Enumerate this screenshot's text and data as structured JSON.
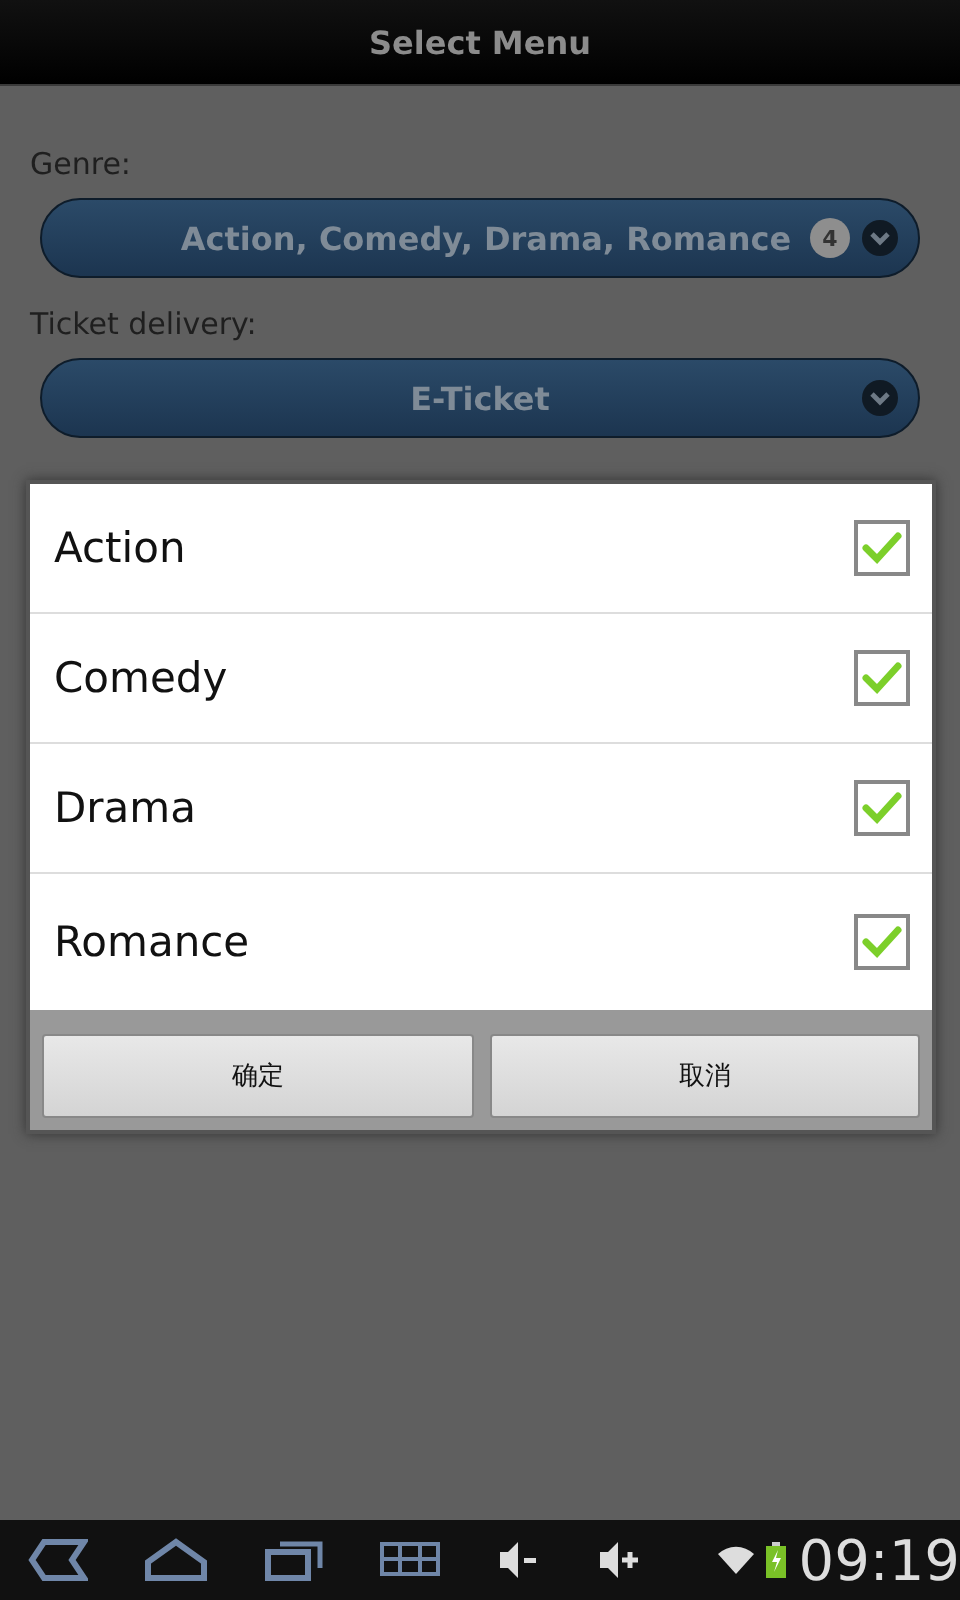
{
  "header": {
    "title": "Select Menu"
  },
  "fields": [
    {
      "label": "Genre:",
      "value": "Action, Comedy, Drama, Romance",
      "count": "4"
    },
    {
      "label": "Ticket delivery:",
      "value": "E-Ticket"
    }
  ],
  "dialog": {
    "options": [
      {
        "label": "Action",
        "checked": true
      },
      {
        "label": "Comedy",
        "checked": true
      },
      {
        "label": "Drama",
        "checked": true
      },
      {
        "label": "Romance",
        "checked": true
      }
    ],
    "buttons": [
      "确定",
      "取消"
    ]
  },
  "status_bar": {
    "time": "09:19"
  }
}
